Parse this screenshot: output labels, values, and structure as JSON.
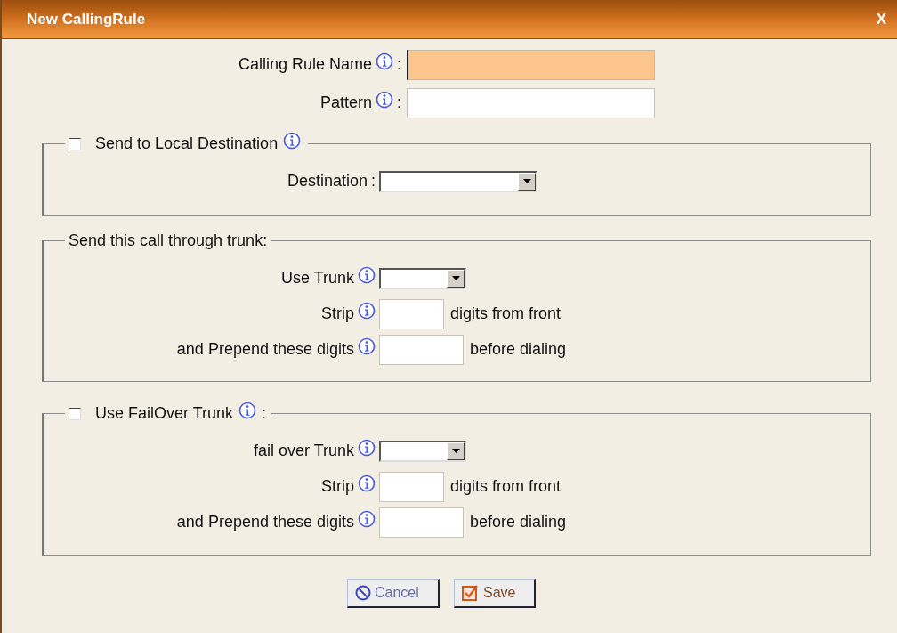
{
  "dialog": {
    "title": "New CallingRule",
    "close": "X"
  },
  "fields": [
    {
      "label": "Calling Rule Name",
      "separator": ":",
      "focused": true
    },
    {
      "label": "Pattern",
      "separator": ":",
      "focused": false
    }
  ],
  "sections": [
    {
      "kind": "checkbox",
      "legend": "Send to Local Destination",
      "checked": false,
      "info": true,
      "rows": [
        {
          "kind": "wide_select",
          "label": "Destination",
          "separator": ":",
          "info": false
        }
      ]
    },
    {
      "kind": "plain",
      "legend": "Send this call through trunk:",
      "info": false,
      "rows": [
        {
          "kind": "select",
          "label": "Use Trunk",
          "info": true
        },
        {
          "kind": "short_text",
          "label": "Strip",
          "info": true,
          "suffix": "digits from front"
        },
        {
          "kind": "text",
          "label": "and Prepend these digits",
          "info": true,
          "suffix": "before dialing"
        }
      ]
    },
    {
      "kind": "checkbox",
      "legend": "Use FailOver Trunk",
      "checked": false,
      "info": true,
      "legend_suffix": ":",
      "rows": [
        {
          "kind": "select",
          "label": "fail over Trunk",
          "info": true
        },
        {
          "kind": "short_text",
          "label": "Strip",
          "info": true,
          "suffix": "digits from front"
        },
        {
          "kind": "text",
          "label": "and Prepend these digits",
          "info": true,
          "suffix": "before dialing"
        }
      ]
    }
  ],
  "buttons": [
    {
      "kind": "cancel",
      "label": "Cancel"
    },
    {
      "kind": "save",
      "label": "Save"
    }
  ]
}
